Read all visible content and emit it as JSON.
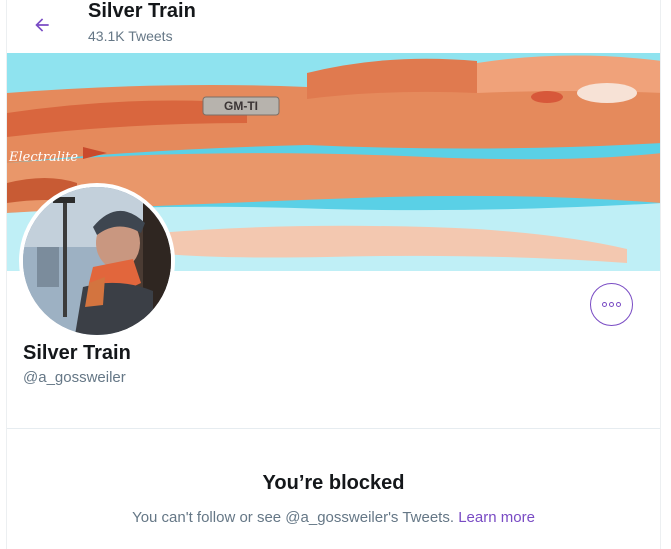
{
  "header": {
    "title": "Silver Train",
    "tweet_count": "43.1K Tweets"
  },
  "profile": {
    "name": "Silver Train",
    "handle": "@a_gossweiler"
  },
  "banner": {
    "badge_text": "GM-TI",
    "script_text": "Electralite"
  },
  "blocked": {
    "title": "You’re blocked",
    "message": "You can't follow or see @a_gossweiler's Tweets.",
    "learn_more": "Learn more"
  },
  "colors": {
    "accent": "#794bc4",
    "text_primary": "#14171a",
    "text_secondary": "#657786"
  },
  "icons": {
    "back": "arrow-left-icon",
    "more": "more-horizontal-icon"
  }
}
